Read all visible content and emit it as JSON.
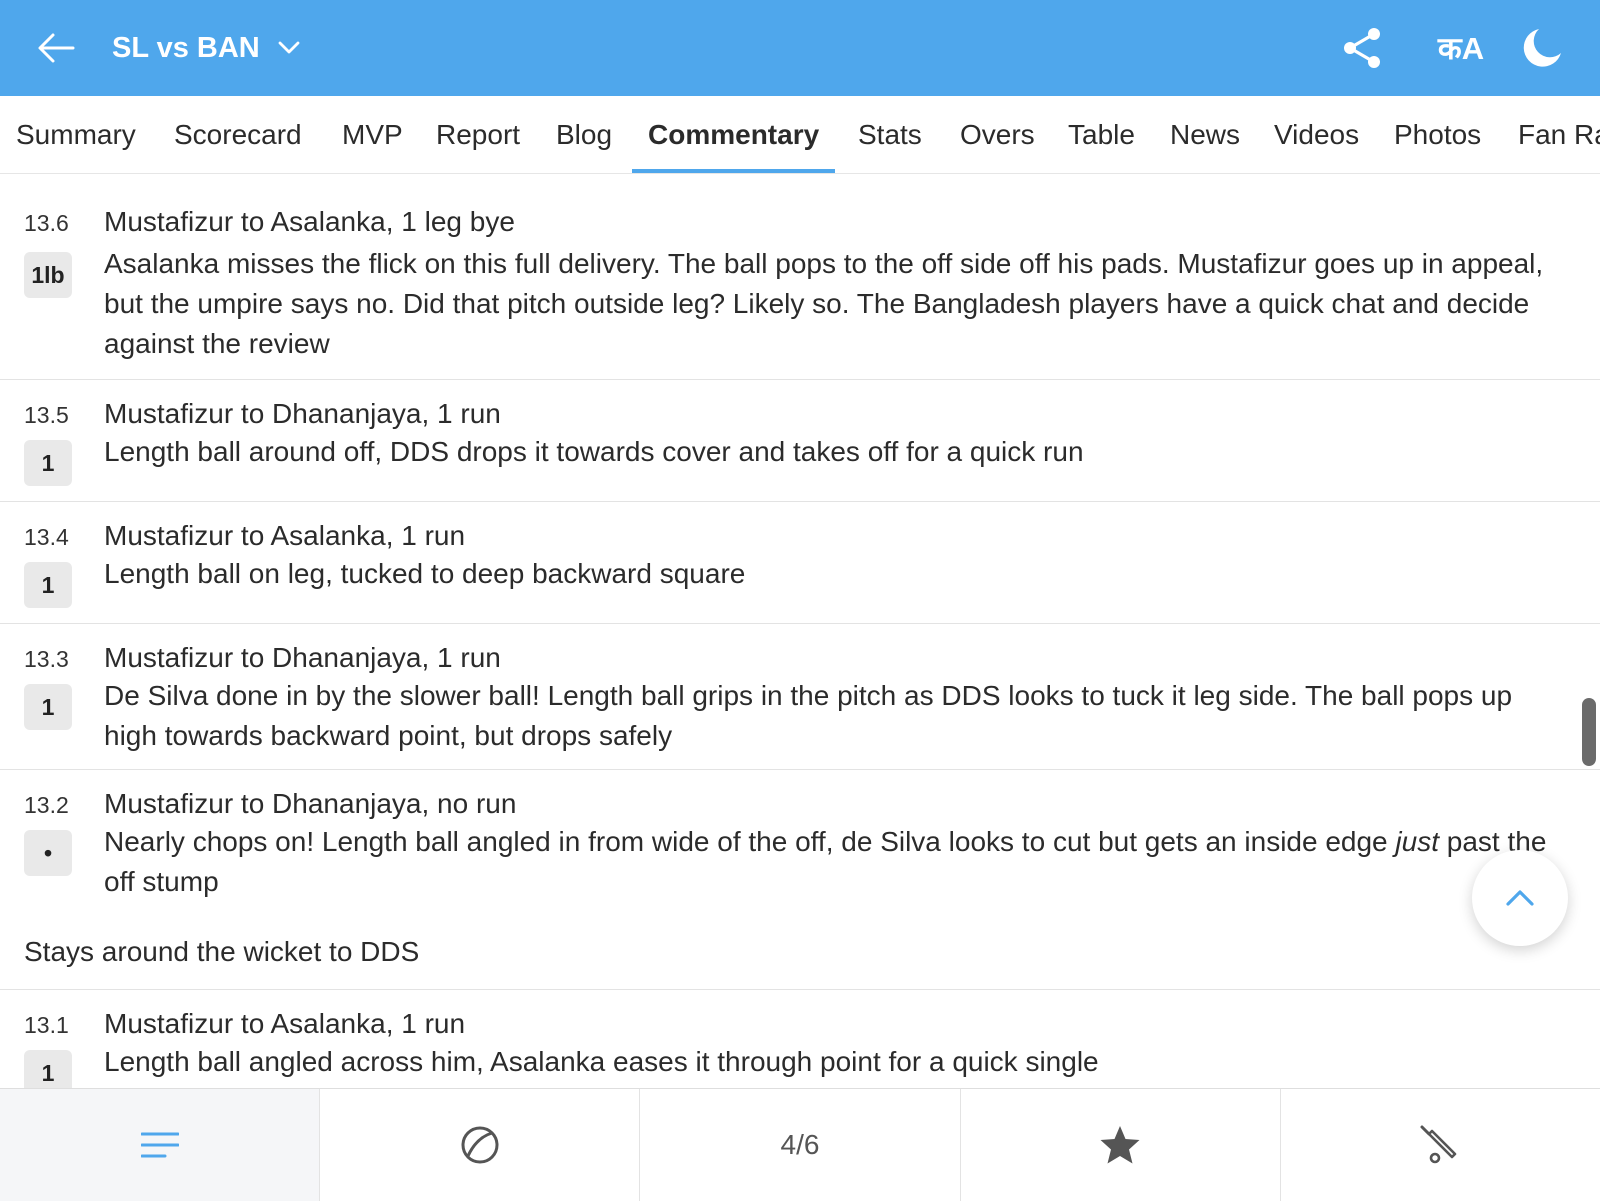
{
  "header": {
    "match_title": "SL vs BAN",
    "icons": [
      "back-arrow-icon",
      "chevron-down-icon",
      "share-icon",
      "language-icon",
      "moon-icon"
    ],
    "lang_icon_text": "कA"
  },
  "tabs": [
    {
      "label": "Summary"
    },
    {
      "label": "Scorecard"
    },
    {
      "label": "MVP"
    },
    {
      "label": "Report"
    },
    {
      "label": "Blog"
    },
    {
      "label": "Commentary",
      "active": true
    },
    {
      "label": "Stats"
    },
    {
      "label": "Overs"
    },
    {
      "label": "Table"
    },
    {
      "label": "News"
    },
    {
      "label": "Videos"
    },
    {
      "label": "Photos"
    },
    {
      "label": "Fan Ra"
    }
  ],
  "commentary": [
    {
      "over": "13.6",
      "badge": "1lb",
      "title": "Mustafizur to Asalanka, 1 leg bye",
      "text": "Asalanka misses the flick on this full delivery. The ball pops to the off side off his pads. Mustafizur goes up in appeal, but the umpire says no. Did that pitch outside leg? Likely so. The Bangladesh players have a quick chat and decide against the review"
    },
    {
      "over": "13.5",
      "badge": "1",
      "title": "Mustafizur to Dhananjaya, 1 run",
      "text": "Length ball around off, DDS drops it towards cover and takes off for a quick run"
    },
    {
      "over": "13.4",
      "badge": "1",
      "title": "Mustafizur to Asalanka, 1 run",
      "text": "Length ball on leg, tucked to deep backward square"
    },
    {
      "over": "13.3",
      "badge": "1",
      "title": "Mustafizur to Dhananjaya, 1 run",
      "text": "De Silva done in by the slower ball! Length ball grips in the pitch as DDS looks to tuck it leg side. The ball pops up high towards backward point, but drops safely"
    },
    {
      "over": "13.2",
      "badge": "•",
      "title": "Mustafizur to Dhananjaya, no run",
      "text_before": "Nearly chops on! Length ball angled in from wide of the off, de Silva looks to cut but gets an inside edge ",
      "text_emphasis": "just",
      "text_after": " past the off stump",
      "note": "Stays around the wicket to DDS"
    },
    {
      "over": "13.1",
      "badge": "1",
      "title": "Mustafizur to Asalanka, 1 run",
      "text": "Length ball angled across him, Asalanka eases it through point for a quick single"
    }
  ],
  "bottom_nav": {
    "items": [
      {
        "icon": "menu-lines-icon",
        "active": true
      },
      {
        "icon": "cricket-ball-icon"
      },
      {
        "label": "4/6"
      },
      {
        "icon": "star-icon"
      },
      {
        "icon": "cricket-bat-icon"
      }
    ]
  },
  "colors": {
    "header_bg": "#4fa7ec",
    "accent": "#4fa7ec",
    "badge_bg": "#e9e9e9",
    "text": "#2b2b2b"
  }
}
